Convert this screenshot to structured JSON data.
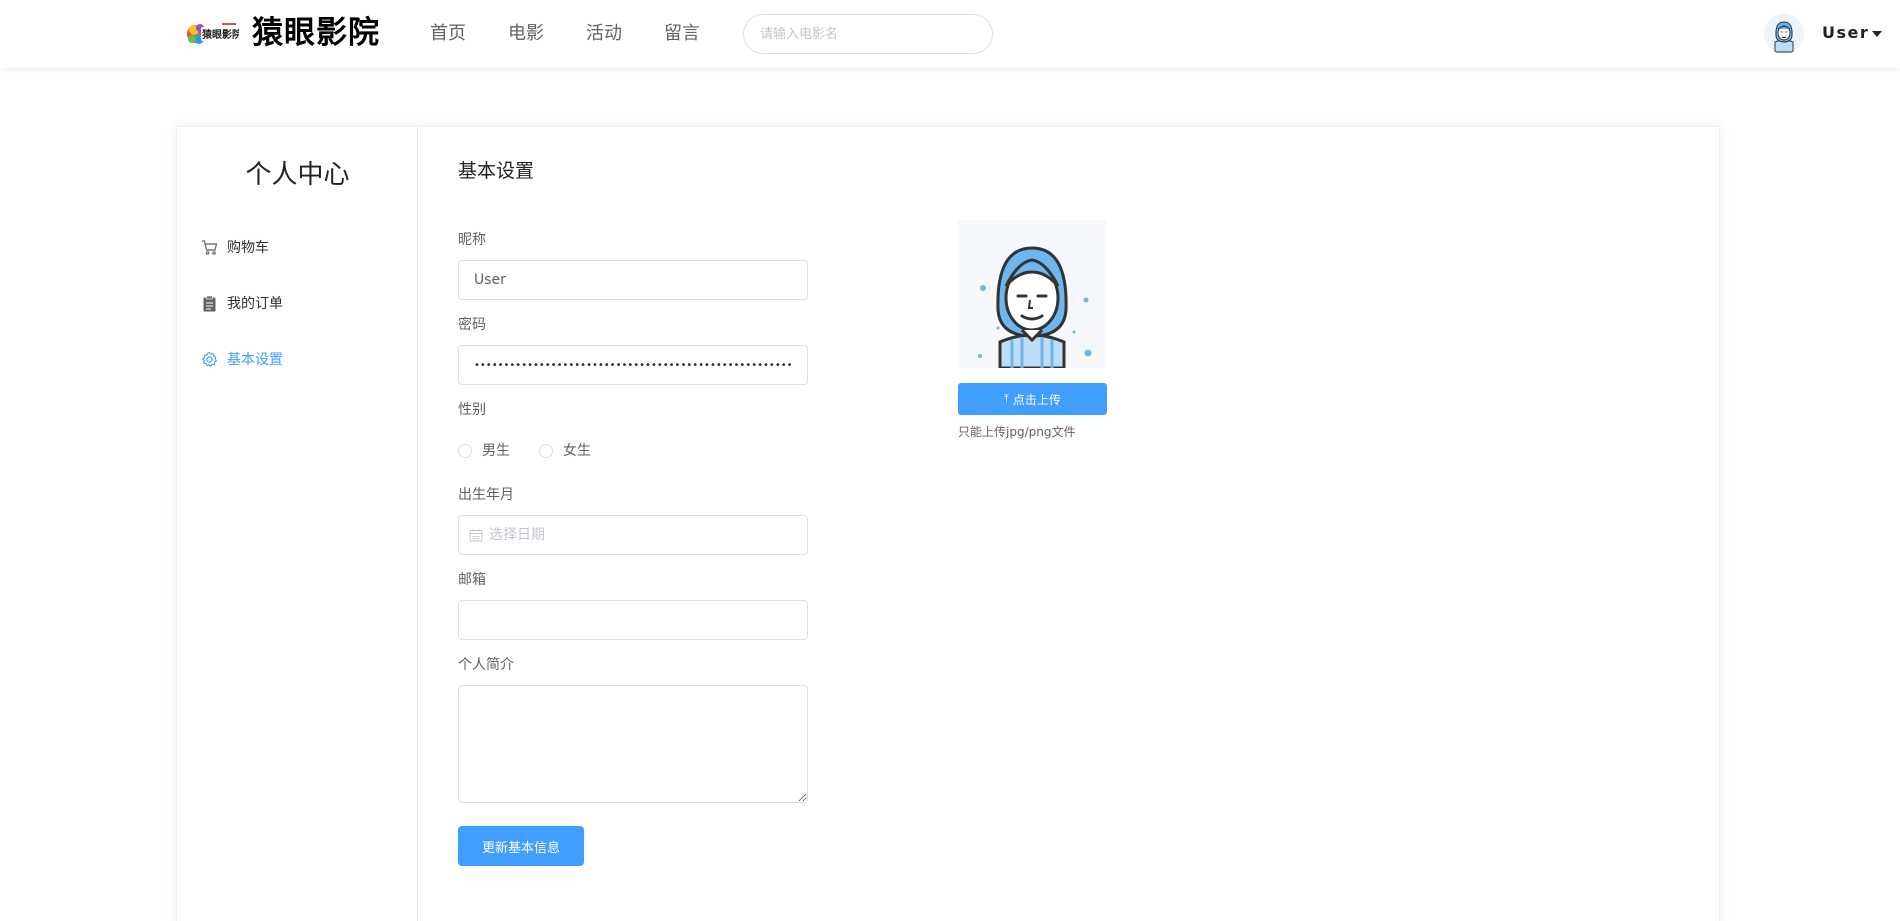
{
  "header": {
    "logo_text": "猿眼影院",
    "nav": [
      {
        "label": "首页"
      },
      {
        "label": "电影"
      },
      {
        "label": "活动"
      },
      {
        "label": "留言"
      }
    ],
    "search_placeholder": "请输入电影名",
    "user_name": "User"
  },
  "sidebar": {
    "title": "个人中心",
    "items": [
      {
        "label": "购物车",
        "icon": "cart-icon"
      },
      {
        "label": "我的订单",
        "icon": "clipboard-icon"
      },
      {
        "label": "基本设置",
        "icon": "gear-icon",
        "active": true
      }
    ]
  },
  "settings": {
    "title": "基本设置",
    "nickname_label": "昵称",
    "nickname_value": "User",
    "password_label": "密码",
    "password_value": "••••••••••••••••••••••••••••••••••••••••••••••••••••••••••••",
    "gender_label": "性别",
    "gender_options": [
      "男生",
      "女生"
    ],
    "birth_label": "出生年月",
    "birth_placeholder": "选择日期",
    "email_label": "邮箱",
    "email_value": "",
    "bio_label": "个人简介",
    "bio_value": "",
    "submit_label": "更新基本信息",
    "upload_label": "点击上传",
    "upload_tip": "只能上传jpg/png文件"
  },
  "colors": {
    "primary": "#409eff",
    "active_text": "#409eff",
    "border": "#dcdfe6"
  }
}
